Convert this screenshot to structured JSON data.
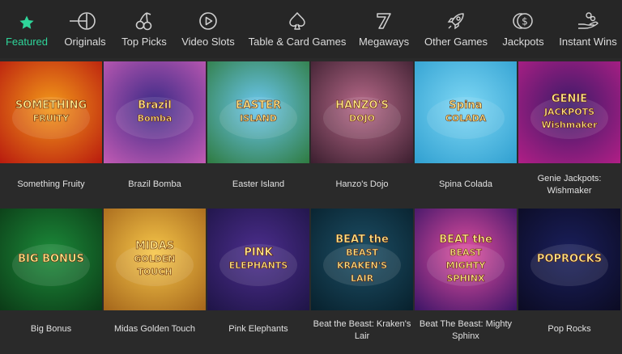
{
  "nav": {
    "items": [
      {
        "label": "Featured",
        "icon": "star-icon",
        "active": true
      },
      {
        "label": "Originals",
        "icon": "originals-icon"
      },
      {
        "label": "Top Picks",
        "icon": "cherries-icon"
      },
      {
        "label": "Video Slots",
        "icon": "play-icon"
      },
      {
        "label": "Table & Card Games",
        "icon": "spade-icon"
      },
      {
        "label": "Megaways",
        "icon": "seven-icon"
      },
      {
        "label": "Other Games",
        "icon": "rocket-icon"
      },
      {
        "label": "Jackpots",
        "icon": "coins-icon"
      },
      {
        "label": "Instant Wins",
        "icon": "hand-coins-icon"
      }
    ],
    "accent_color": "#2fd59a"
  },
  "games": [
    {
      "title": "Something Fruity",
      "art_text": "SOMETHING FRUITY",
      "colors": [
        "#f39a1a",
        "#b8190e"
      ]
    },
    {
      "title": "Brazil Bomba",
      "art_text": "Brazil Bomba",
      "colors": [
        "#3a2a86",
        "#c45bb4"
      ]
    },
    {
      "title": "Easter Island",
      "art_text": "EASTER ISLAND",
      "colors": [
        "#6bc7ef",
        "#2e7a3e"
      ]
    },
    {
      "title": "Hanzo's Dojo",
      "art_text": "HANZO'S DOJO",
      "colors": [
        "#b86a8a",
        "#3a1e2e"
      ]
    },
    {
      "title": "Spina Colada",
      "art_text": "Spina COLADA",
      "colors": [
        "#7fd8f5",
        "#2f9fd0"
      ]
    },
    {
      "title": "Genie Jackpots: Wishmaker",
      "art_text": "GENIE JACKPOTS Wishmaker",
      "colors": [
        "#3a1a68",
        "#b21f86"
      ]
    },
    {
      "title": "Big Bonus",
      "art_text": "BIG BONUS",
      "colors": [
        "#1c8b3a",
        "#0b3a16"
      ]
    },
    {
      "title": "Midas Golden Touch",
      "art_text": "MIDAS GOLDEN TOUCH",
      "colors": [
        "#f7c74a",
        "#a3641a"
      ]
    },
    {
      "title": "Pink Elephants",
      "art_text": "PINK ELEPHANTS",
      "colors": [
        "#4c2e8e",
        "#1e1446"
      ]
    },
    {
      "title": "Beat the Beast: Kraken's Lair",
      "art_text": "BEAT the BEAST KRAKEN'S LAIR",
      "colors": [
        "#1d4f66",
        "#07202c"
      ]
    },
    {
      "title": "Beat The Beast: Mighty Sphinx",
      "art_text": "BEAT the BEAST MIGHTY SPHINX",
      "colors": [
        "#e34fa0",
        "#3a1466"
      ]
    },
    {
      "title": "Pop Rocks",
      "art_text": "POPROCKS",
      "colors": [
        "#1a1f5c",
        "#0b0b22"
      ]
    }
  ]
}
